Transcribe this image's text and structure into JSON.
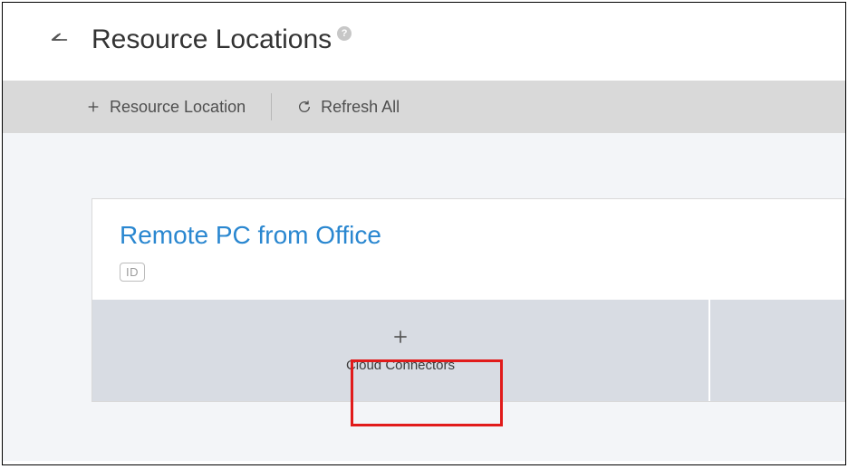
{
  "header": {
    "title": "Resource Locations",
    "help_symbol": "?"
  },
  "toolbar": {
    "add_label": "Resource Location",
    "refresh_label": "Refresh All"
  },
  "card": {
    "title": "Remote PC from Office",
    "id_badge": "ID",
    "action_label": "Cloud Connectors"
  }
}
